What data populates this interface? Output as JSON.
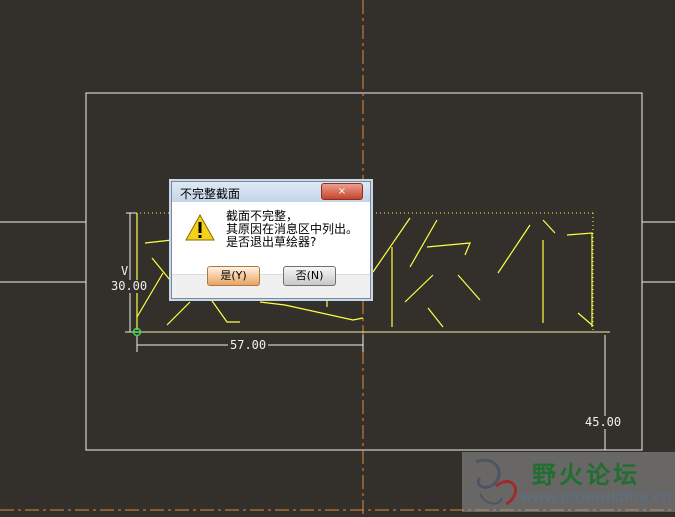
{
  "dialog": {
    "title": "不完整截面",
    "close_label": "×",
    "message": [
      "截面不完整，",
      "其原因在消息区中列出。",
      "是否退出草绘器?"
    ],
    "yes_label": "是(Y)",
    "no_label": "否(N)"
  },
  "sketch": {
    "dim_vertical": "30.00",
    "dim_vertical_marker": "V",
    "dim_horizontal": "57.00",
    "dim_right": "45.00"
  },
  "watermark": {
    "title": "野火论坛",
    "url": "www.proewildfire.cn"
  },
  "colors": {
    "background": "#33302b",
    "sketch": "#ffff44",
    "centerline": "#e08a3a",
    "dialog_yes": "#f4c89a"
  }
}
